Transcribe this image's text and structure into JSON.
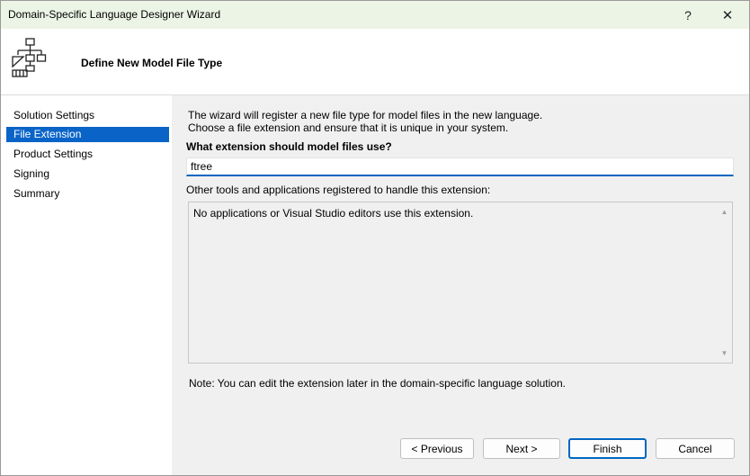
{
  "window": {
    "title": "Domain-Specific Language Designer Wizard",
    "help_glyph": "?",
    "close_glyph": "✕"
  },
  "header": {
    "title": "Define New Model File Type",
    "icon": "hierarchy-diagram-icon"
  },
  "nav": {
    "items": [
      {
        "label": "Solution Settings",
        "selected": false
      },
      {
        "label": "File Extension",
        "selected": true
      },
      {
        "label": "Product Settings",
        "selected": false
      },
      {
        "label": "Signing",
        "selected": false
      },
      {
        "label": "Summary",
        "selected": false
      }
    ]
  },
  "content": {
    "description_line1": "The wizard will register a new file type for model files in the new language.",
    "description_line2": "Choose a file extension and ensure that it is unique in your system.",
    "question": "What extension should model files use?",
    "extension_value": "ftree",
    "other_tools_label": "Other tools and applications registered to handle this extension:",
    "registered_list": "No applications or Visual Studio editors use this extension.",
    "note": "Note: You can edit the extension later in the domain-specific language solution."
  },
  "buttons": {
    "previous": "< Previous",
    "next": "Next >",
    "finish": "Finish",
    "cancel": "Cancel"
  },
  "colors": {
    "selection": "#0a64c8",
    "focus_accent": "#0067c0",
    "titlebar": "#ecf4e6"
  }
}
